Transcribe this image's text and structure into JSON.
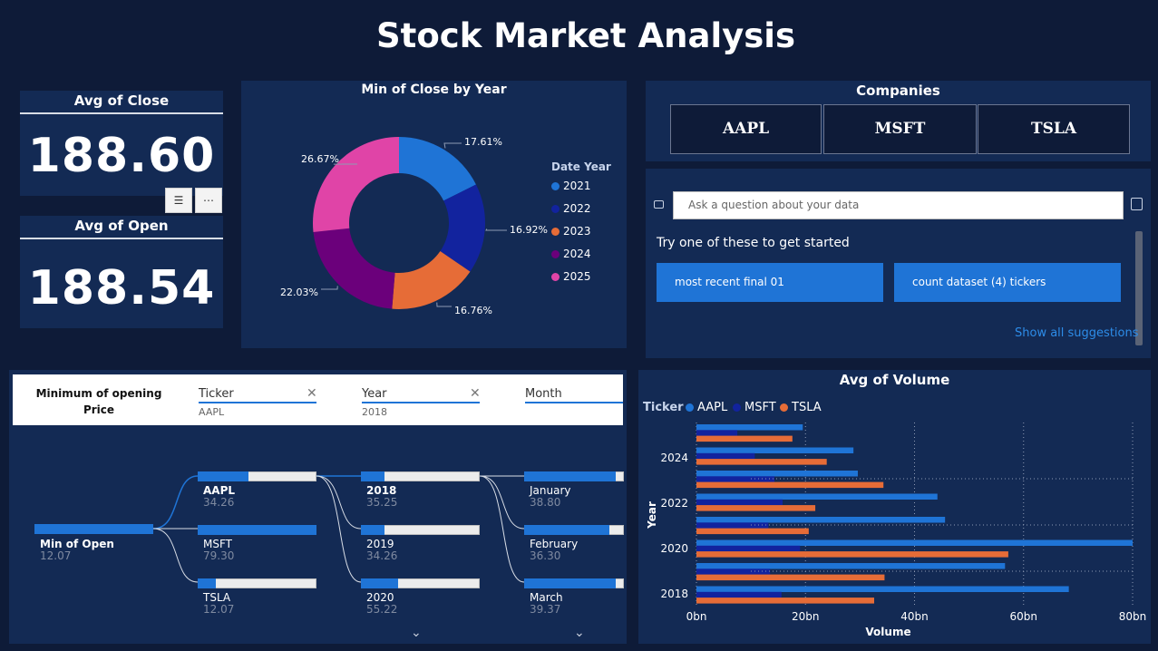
{
  "page_title": "Stock Market Analysis",
  "kpis": {
    "close_title": "Avg of Close",
    "close_value": "188.60",
    "open_title": "Avg of Open",
    "open_value": "188.54"
  },
  "donut": {
    "title": "Min of Close by Year",
    "legend_title": "Date Year",
    "slices": [
      {
        "label": "2021",
        "pct": 17.61,
        "pct_label": "17.61%",
        "color": "#1f74d6"
      },
      {
        "label": "2022",
        "pct": 16.92,
        "pct_label": "16.92%",
        "color": "#12239e"
      },
      {
        "label": "2023",
        "pct": 16.76,
        "pct_label": "16.76%",
        "color": "#e66c37"
      },
      {
        "label": "2024",
        "pct": 22.03,
        "pct_label": "22.03%",
        "color": "#6b007b"
      },
      {
        "label": "2025",
        "pct": 26.67,
        "pct_label": "26.67%",
        "color": "#e044a7"
      }
    ]
  },
  "companies": {
    "title": "Companies",
    "buttons": [
      "AAPL",
      "MSFT",
      "TSLA"
    ]
  },
  "qa": {
    "placeholder": "Ask a question about your data",
    "prompt": "Try one of these to get started",
    "suggestions": [
      "most recent final 01",
      "count dataset (4) tickers"
    ],
    "show_all": "Show all suggestions"
  },
  "decomp": {
    "title": "Minimum of opening Price",
    "fields": [
      {
        "name": "Ticker",
        "value": "AAPL"
      },
      {
        "name": "Year",
        "value": "2018"
      },
      {
        "name": "Month",
        "value": ""
      }
    ],
    "root": {
      "label": "Min of Open",
      "value": "12.07"
    },
    "tickers": [
      {
        "label": "AAPL",
        "value": "34.26",
        "fill": 0.43
      },
      {
        "label": "MSFT",
        "value": "79.30",
        "fill": 1.0
      },
      {
        "label": "TSLA",
        "value": "12.07",
        "fill": 0.15
      }
    ],
    "years": [
      {
        "label": "2018",
        "value": "35.25",
        "fill": 0.2
      },
      {
        "label": "2019",
        "value": "34.26",
        "fill": 0.2
      },
      {
        "label": "2020",
        "value": "55.22",
        "fill": 0.31
      }
    ],
    "months": [
      {
        "label": "January",
        "value": "38.80",
        "fill": 0.92
      },
      {
        "label": "February",
        "value": "36.30",
        "fill": 0.85
      },
      {
        "label": "March",
        "value": "39.37",
        "fill": 0.92
      }
    ]
  },
  "volume_chart": {
    "title": "Avg of Volume",
    "legend_title": "Ticker",
    "xlabel": "Volume",
    "ylabel": "Year",
    "x_ticks": [
      "0bn",
      "20bn",
      "40bn",
      "60bn",
      "80bn"
    ],
    "y_ticks": [
      "2024",
      "2022",
      "2020",
      "2018"
    ]
  },
  "chart_data": {
    "type": "bar",
    "orientation": "horizontal",
    "title": "Avg of Volume",
    "xlabel": "Volume",
    "ylabel": "Year",
    "categories": [
      "2025",
      "2024",
      "2023",
      "2022",
      "2021",
      "2020",
      "2019",
      "2018"
    ],
    "xlim": [
      0,
      80
    ],
    "series": [
      {
        "name": "AAPL",
        "color": "#1f74d6",
        "values": [
          19.5,
          28.8,
          29.6,
          44.2,
          45.6,
          80.0,
          56.6,
          68.3
        ]
      },
      {
        "name": "MSFT",
        "color": "#12239e",
        "values": [
          7.5,
          10.7,
          14.3,
          15.8,
          13.2,
          19.0,
          13.5,
          15.6
        ]
      },
      {
        "name": "TSLA",
        "color": "#e66c37",
        "values": [
          17.6,
          23.9,
          34.3,
          21.8,
          20.6,
          57.2,
          34.5,
          32.6
        ]
      }
    ],
    "grid": true,
    "legend": "top-left"
  }
}
